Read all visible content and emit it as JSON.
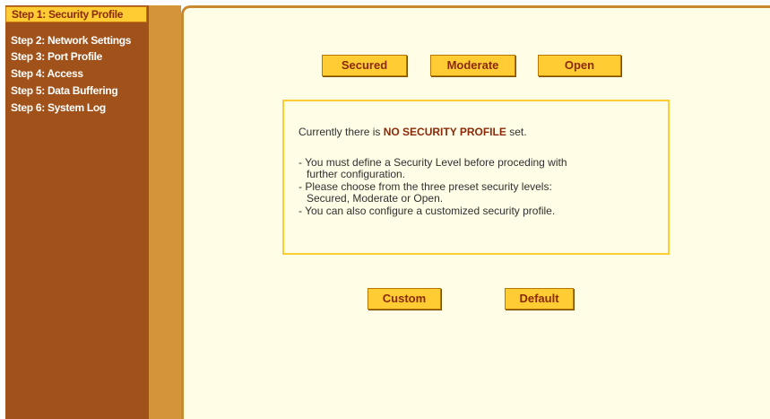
{
  "sidebar": {
    "items": [
      {
        "label": "Step 1: Security Profile",
        "active": true
      },
      {
        "label": "Step 2: Network Settings",
        "active": false
      },
      {
        "label": "Step 3: Port Profile",
        "active": false
      },
      {
        "label": "Step 4: Access",
        "active": false
      },
      {
        "label": "Step 5: Data Buffering",
        "active": false
      },
      {
        "label": "Step 6: System Log",
        "active": false
      }
    ]
  },
  "profile_buttons": {
    "secured": "Secured",
    "moderate": "Moderate",
    "open": "Open"
  },
  "info": {
    "status_prefix": "Currently there is",
    "status_emphasis": "NO SECURITY PROFILE",
    "status_suffix": "set.",
    "lines": [
      "- You must define a Security Level before proceding with",
      "  further configuration.",
      "- Please choose from the three preset security levels:",
      "  Secured, Moderate or Open.",
      "- You can also configure a customized security profile."
    ]
  },
  "bottom_buttons": {
    "custom": "Custom",
    "default": "Default"
  },
  "colors": {
    "sidebar_bg": "#a0521a",
    "active_item_bg": "#ffcc33",
    "content_bg": "#fffde6",
    "button_bg": "#ffcc33",
    "button_text": "#8a2a0a"
  }
}
